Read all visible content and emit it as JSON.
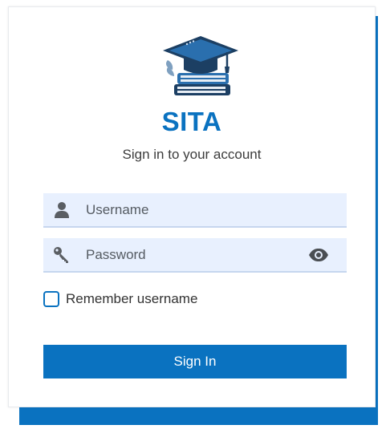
{
  "brand": {
    "name": "SITA",
    "logo_icon": "graduation-cap-books-icon"
  },
  "subtitle": "Sign in to your account",
  "form": {
    "username": {
      "placeholder": "Username",
      "value": "",
      "icon": "user-icon"
    },
    "password": {
      "placeholder": "Password",
      "value": "",
      "icon": "key-icon",
      "toggle_icon": "eye-icon"
    },
    "remember": {
      "label": "Remember username",
      "checked": false
    },
    "submit_label": "Sign In"
  },
  "colors": {
    "accent": "#0a72c0",
    "field_bg": "#e8f0fe"
  }
}
